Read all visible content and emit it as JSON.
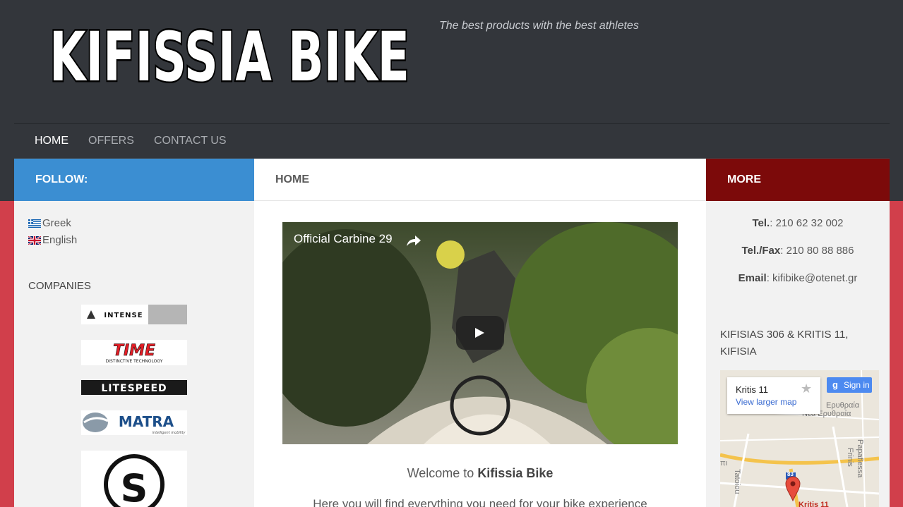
{
  "header": {
    "logo_text": "KIFISSIA BIKE",
    "tagline": "The best products with the best athletes"
  },
  "nav": [
    {
      "label": "HOME"
    },
    {
      "label": "OFFERS"
    },
    {
      "label": "CONTACT US"
    }
  ],
  "left": {
    "title": "FOLLOW:",
    "languages": [
      {
        "label": "Greek"
      },
      {
        "label": "English"
      }
    ],
    "companies_title": "COMPANIES",
    "brands": [
      "INTENSE",
      "TIME",
      "DISTINCTIVE TECHNOLOGY",
      "LITESPEED",
      "MATRA",
      "intelligent mobility",
      "S"
    ]
  },
  "main": {
    "title": "HOME",
    "video_title": "Official Carbine 29",
    "welcome_prefix": "Welcome to ",
    "welcome_brand": "Kifissia Bike",
    "intro": "Here you will find everything you need for your bike experience"
  },
  "right": {
    "title": "MORE",
    "tel_label": "Tel.",
    "tel_value": ": 210 62 32 002",
    "fax_label": "Tel./Fax",
    "fax_value": ": 210 80 88 886",
    "email_label": "Email",
    "email_value": ": kifibike@otenet.gr",
    "address": "KIFISIAS 306 & KRITIS 11, KIFISIA",
    "map": {
      "place": "Kritis 11",
      "larger_map": "View larger map",
      "sign_in": "Sign in",
      "g_letter": "g",
      "star": "★",
      "labels": [
        "Ερυθραία",
        "Νέα Ερυθραία",
        "Frinis",
        "Papaflessa",
        "Tatoiou",
        "πι",
        "Kritis 11",
        "83"
      ]
    }
  },
  "colors": {
    "header_bg": "#33363b",
    "page_bg": "#d13f4b",
    "follow_bg": "#3b8ed2",
    "more_bg": "#7c0a0a"
  }
}
